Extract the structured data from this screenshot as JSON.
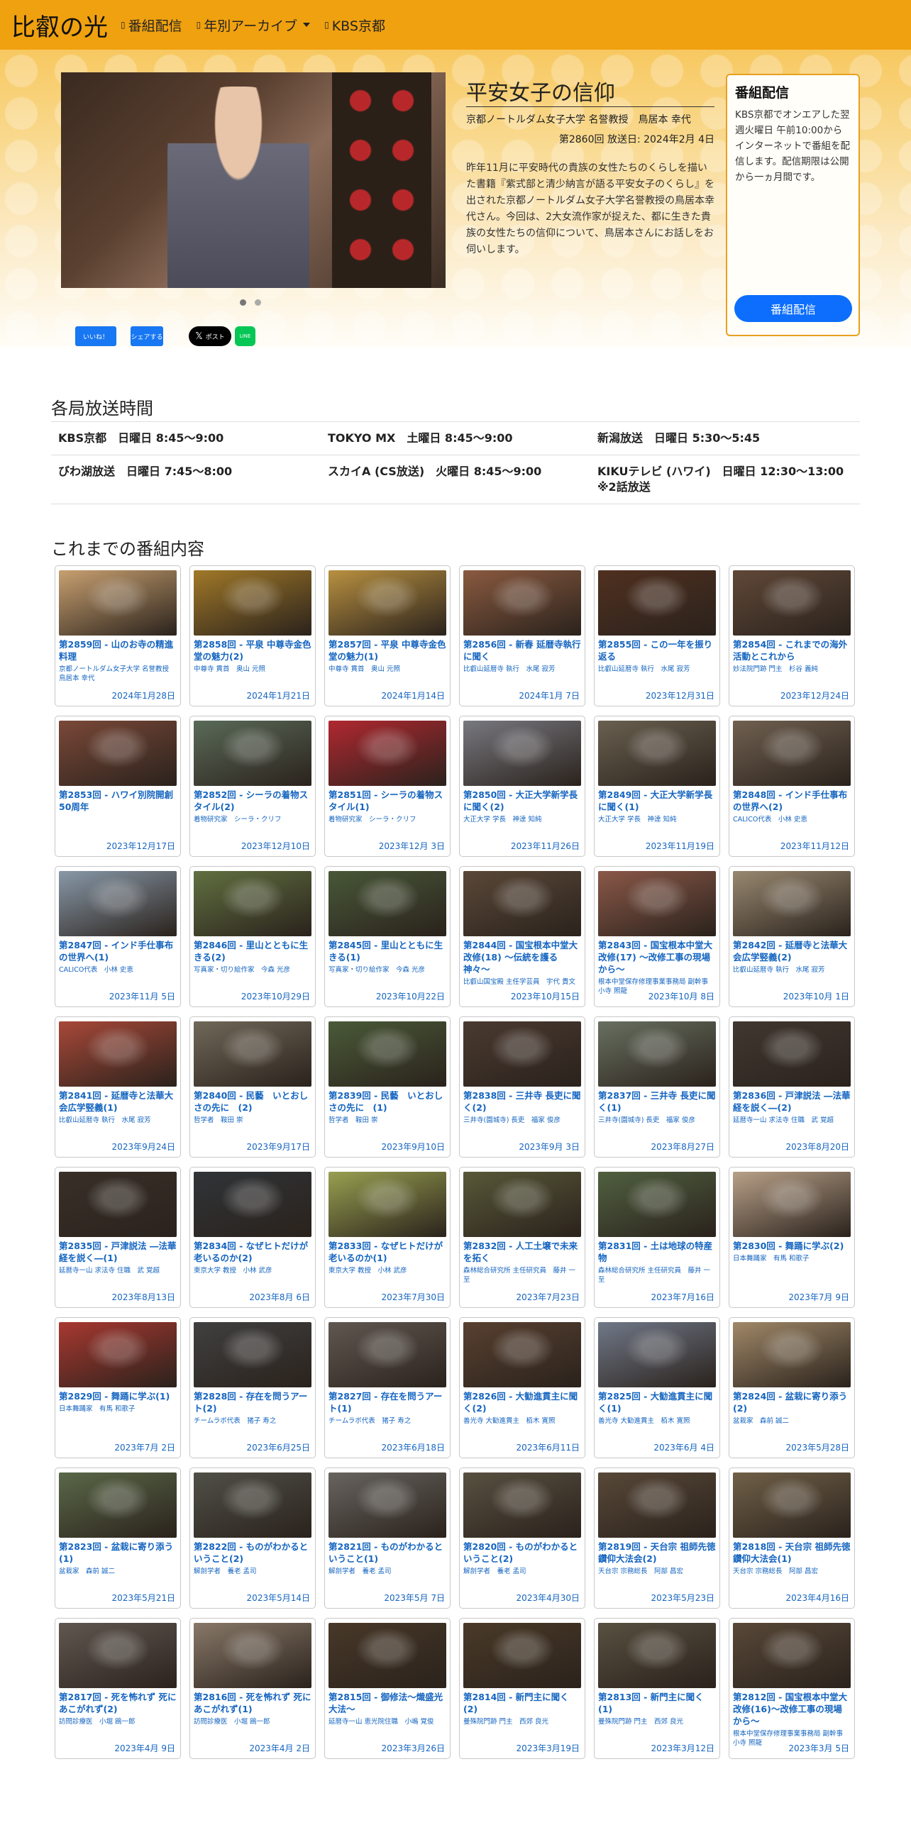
{
  "navbar": {
    "brand": "比叡の光",
    "items": [
      {
        "label": "番組配信",
        "icon": "square-icon"
      },
      {
        "label": "年別アーカイブ",
        "icon": "square-icon",
        "dropdown": true
      },
      {
        "label": "KBS京都",
        "icon": "square-icon"
      }
    ]
  },
  "hero": {
    "title": "平安女子の信仰",
    "guest": "京都ノートルダム女子大学 名誉教授　鳥居本 幸代",
    "air": "第2860回 放送日: 2024年2月 4日",
    "description": "昨年11月に平安時代の貴族の女性たちのくらしを描いた書籍『紫式部と清少納言が語る平安女子のくらし』を出された京都ノートルダム女子大学名誉教授の鳥居本幸代さん。今回は、2大女流作家が捉えた、都に生きた貴族の女性たちの信仰について、鳥居本さんにお話しをお伺いします。",
    "share_buttons": [
      "いいね！",
      "シェアする",
      "ポスト",
      "LINE"
    ]
  },
  "sidebar": {
    "title": "番組配信",
    "text": "KBS京都でオンエアした翌週火曜日 午前10:00からインターネットで番組を配信します。配信期限は公開から一ヵ月間です。",
    "button": "番組配信"
  },
  "schedule": {
    "heading": "各局放送時間",
    "rows": [
      [
        "KBS京都　日曜日 8:45〜9:00",
        "TOKYO MX　土曜日 8:45〜9:00",
        "新潟放送　日曜日 5:30〜5:45"
      ],
      [
        "びわ湖放送　日曜日 7:45〜8:00",
        "スカイA (CS放送)　火曜日 8:45〜9:00",
        "KIKUテレビ (ハワイ)　日曜日 12:30〜13:00\n※2話放送"
      ]
    ]
  },
  "archive": {
    "heading": "これまでの番組内容",
    "episodes": [
      {
        "title": "第2859回 - 山のお寺の精進料理",
        "guest": "京都ノートルダム女子大学 名誉教授　鳥居本 幸代",
        "date": "2024年1月28日",
        "color": "#c8a070"
      },
      {
        "title": "第2858回 - 平泉 中尊寺金色堂の魅力(2)",
        "guest": "中尊寺 貫首　奥山 元照",
        "date": "2024年1月21日",
        "color": "#a07828"
      },
      {
        "title": "第2857回 - 平泉 中尊寺金色堂の魅力(1)",
        "guest": "中尊寺 貫首　奥山 元照",
        "date": "2024年1月14日",
        "color": "#b89040"
      },
      {
        "title": "第2856回 - 新春 延暦寺執行に聞く",
        "guest": "比叡山延暦寺 執行　水尾 寂芳",
        "date": "2024年1月 7日",
        "color": "#8a5a40"
      },
      {
        "title": "第2855回 - この一年を振り返る",
        "guest": "比叡山延暦寺 執行　水尾 寂芳",
        "date": "2023年12月31日",
        "color": "#503020"
      },
      {
        "title": "第2854回 - これまでの海外活動とこれから",
        "guest": "妙法院門跡 門主　杉谷 義純",
        "date": "2023年12月24日",
        "color": "#604838"
      },
      {
        "title": "第2853回 - ハワイ別院開創50周年",
        "guest": "",
        "date": "2023年12月17日",
        "color": "#7a4838"
      },
      {
        "title": "第2852回 - シーラの着物スタイル(2)",
        "guest": "着物研究家　シーラ・クリフ",
        "date": "2023年12月10日",
        "color": "#5a6a58"
      },
      {
        "title": "第2851回 - シーラの着物スタイル(1)",
        "guest": "着物研究家　シーラ・クリフ",
        "date": "2023年12月 3日",
        "color": "#b02830"
      },
      {
        "title": "第2850回 - 大正大学新学長に聞く(2)",
        "guest": "大正大学 学長　神達 知純",
        "date": "2023年11月26日",
        "color": "#787880"
      },
      {
        "title": "第2849回 - 大正大学新学長に聞く(1)",
        "guest": "大正大学 学長　神達 知純",
        "date": "2023年11月19日",
        "color": "#6a6050"
      },
      {
        "title": "第2848回 - インド手仕事布の世界へ(2)",
        "guest": "CALICO代表　小林 史恵",
        "date": "2023年11月12日",
        "color": "#706050"
      },
      {
        "title": "第2847回 - インド手仕事布の世界へ(1)",
        "guest": "CALICO代表　小林 史恵",
        "date": "2023年11月 5日",
        "color": "#8898a8"
      },
      {
        "title": "第2846回 - 里山とともに生きる(2)",
        "guest": "写真家・切り絵作家　今森 光彦",
        "date": "2023年10月29日",
        "color": "#607040"
      },
      {
        "title": "第2845回 - 里山とともに生きる(1)",
        "guest": "写真家・切り絵作家　今森 光彦",
        "date": "2023年10月22日",
        "color": "#485838"
      },
      {
        "title": "第2844回 - 国宝根本中堂大改修(18) 〜伝統を護る神々〜",
        "guest": "比叡山国宝殿 主任学芸員　宇代 貴文",
        "date": "2023年10月15日",
        "color": "#5a4838"
      },
      {
        "title": "第2843回 - 国宝根本中堂大改修(17) 〜改修工事の現場から〜",
        "guest": "根本中堂保存修理事業事務局 副幹事　小寺 照龍",
        "date": "2023年10月 8日",
        "color": "#8a5848"
      },
      {
        "title": "第2842回 - 延暦寺と法華大会広学竪義(2)",
        "guest": "比叡山延暦寺 執行　水尾 寂芳",
        "date": "2023年10月 1日",
        "color": "#988870"
      },
      {
        "title": "第2841回 - 延暦寺と法華大会広学竪義(1)",
        "guest": "比叡山延暦寺 執行　水尾 寂芳",
        "date": "2023年9月24日",
        "color": "#a84838"
      },
      {
        "title": "第2840回 - 民藝　いとおしさの先に　(2)",
        "guest": "哲学者　鞍田 崇",
        "date": "2023年9月17日",
        "color": "#706858"
      },
      {
        "title": "第2839回 - 民藝　いとおしさの先に　(1)",
        "guest": "哲学者　鞍田 崇",
        "date": "2023年9月10日",
        "color": "#4a5a38"
      },
      {
        "title": "第2838回 - 三井寺 長吏に聞く(2)",
        "guest": "三井寺(園城寺) 長吏　福家 俊彦",
        "date": "2023年9月 3日",
        "color": "#4a3a30"
      },
      {
        "title": "第2837回 - 三井寺 長吏に聞く(1)",
        "guest": "三井寺(園城寺) 長吏　福家 俊彦",
        "date": "2023年8月27日",
        "color": "#687060"
      },
      {
        "title": "第2836回 - 戸津説法 ―法華経を説く―(2)",
        "guest": "延暦寺一山 求法寺 住職　武 覚超",
        "date": "2023年8月20日",
        "color": "#403830"
      },
      {
        "title": "第2835回 - 戸津説法 ―法華経を説く―(1)",
        "guest": "延暦寺一山 求法寺 住職　武 覚超",
        "date": "2023年8月13日",
        "color": "#383028"
      },
      {
        "title": "第2834回 - なぜヒトだけが老いるのか(2)",
        "guest": "東京大学 教授　小林 武彦",
        "date": "2023年8月 6日",
        "color": "#303438"
      },
      {
        "title": "第2833回 - なぜヒトだけが老いるのか(1)",
        "guest": "東京大学 教授　小林 武彦",
        "date": "2023年7月30日",
        "color": "#98a050"
      },
      {
        "title": "第2832回 - 人工土壌で未来を拓く",
        "guest": "森林総合研究所 主任研究員　藤井 一至",
        "date": "2023年7月23日",
        "color": "#585838"
      },
      {
        "title": "第2831回 - 土は地球の特産物",
        "guest": "森林総合研究所 主任研究員　藤井 一至",
        "date": "2023年7月16日",
        "color": "#506040"
      },
      {
        "title": "第2830回 - 舞踊に学ぶ(2)",
        "guest": "日本舞踊家　有馬 和歌子",
        "date": "2023年7月 9日",
        "color": "#b8a088"
      },
      {
        "title": "第2829回 - 舞踊に学ぶ(1)",
        "guest": "日本舞踊家　有馬 和歌子",
        "date": "2023年7月 2日",
        "color": "#a83830"
      },
      {
        "title": "第2828回 - 存在を問うアート(2)",
        "guest": "チームラボ代表　猪子 寿之",
        "date": "2023年6月25日",
        "color": "#404040"
      },
      {
        "title": "第2827回 - 存在を問うアート(1)",
        "guest": "チームラボ代表　猪子 寿之",
        "date": "2023年6月18日",
        "color": "#605850"
      },
      {
        "title": "第2826回 - 大勧進貫主に聞く(2)",
        "guest": "善光寺 大勧進貫主　栢木 寛照",
        "date": "2023年6月11日",
        "color": "#584030"
      },
      {
        "title": "第2825回 - 大勧進貫主に聞く(1)",
        "guest": "善光寺 大勧進貫主　栢木 寛照",
        "date": "2023年6月 4日",
        "color": "#707888"
      },
      {
        "title": "第2824回 - 盆栽に寄り添う(2)",
        "guest": "盆栽家　森前 誠二",
        "date": "2023年5月28日",
        "color": "#a08868"
      },
      {
        "title": "第2823回 - 盆栽に寄り添う(1)",
        "guest": "盆栽家　森前 誠二",
        "date": "2023年5月21日",
        "color": "#5a6848"
      },
      {
        "title": "第2822回 - ものがわかるということ(2)",
        "guest": "解剖学者　養老 孟司",
        "date": "2023年5月14日",
        "color": "#505048"
      },
      {
        "title": "第2821回 - ものがわかるということ(1)",
        "guest": "解剖学者　養老 孟司",
        "date": "2023年5月 7日",
        "color": "#686460"
      },
      {
        "title": "第2820回 - ものがわかるということ(2)",
        "guest": "解剖学者　養老 孟司",
        "date": "2023年4月30日",
        "color": "#585040"
      },
      {
        "title": "第2819回 - 天台宗 祖師先徳鑽仰大法会(2)",
        "guest": "天台宗 宗務総長　阿部 昌宏",
        "date": "2023年5月23日",
        "color": "#584838"
      },
      {
        "title": "第2818回 - 天台宗 祖師先徳鑽仰大法会(1)",
        "guest": "天台宗 宗務総長　阿部 昌宏",
        "date": "2023年4月16日",
        "color": "#706048"
      },
      {
        "title": "第2817回 - 死を怖れず 死にあこがれず(2)",
        "guest": "訪問診療医　小堀 鴎一郎",
        "date": "2023年4月 9日",
        "color": "#605850"
      },
      {
        "title": "第2816回 - 死を怖れず 死にあこがれず(1)",
        "guest": "訪問診療医　小堀 鴎一郎",
        "date": "2023年4月 2日",
        "color": "#887868"
      },
      {
        "title": "第2815回 - 御修法〜熾盛光大法〜",
        "guest": "延暦寺一山 恵光院住職　小嶋 覚俊",
        "date": "2023年3月26日",
        "color": "#483828"
      },
      {
        "title": "第2814回 - 新門主に聞く(2)",
        "guest": "曼殊院門跡 門主　西郊 良光",
        "date": "2023年3月19日",
        "color": "#4a3a28"
      },
      {
        "title": "第2813回 - 新門主に聞く(1)",
        "guest": "曼殊院門跡 門主　西郊 良光",
        "date": "2023年3月12日",
        "color": "#585040"
      },
      {
        "title": "第2812回 - 国宝根本中堂大改修(16)〜改修工事の現場から〜",
        "guest": "根本中堂保存修理事業事務局 副幹事　小寺 照龍",
        "date": "2023年3月 5日",
        "color": "#584838"
      }
    ]
  },
  "colors": {
    "accent": "#f0a10f",
    "link": "#1565c0",
    "button": "#0d6efd"
  }
}
